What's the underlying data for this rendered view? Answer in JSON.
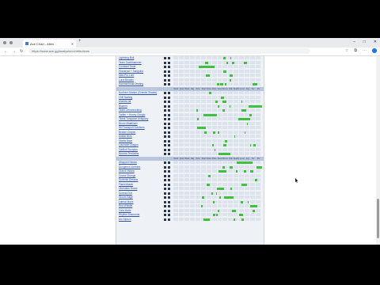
{
  "browser": {
    "tab_title": "Ace Chart - Alten",
    "url": "https://www.ace.gg/analysis/contributions",
    "icons": [
      "back-icon",
      "forward-icon",
      "reload-icon",
      "star-icon",
      "extensions-icon",
      "profile-icon",
      "menu-icon"
    ]
  },
  "table": {
    "column_labels": [
      "Rank",
      "Qual",
      "Week",
      "Day",
      "Time",
      "Total",
      "Notes",
      "Pace",
      "Seed",
      "Bonus",
      "Kills",
      "Deaths",
      "Level",
      "Avg",
      "Tier",
      "Pts"
    ],
    "groups": [
      {
        "players": [
          "Lightning Bolt",
          "Team Gachihammer",
          "Constant Droid",
          "Flowerpot + Sanguine",
          "Idea Pro Lord",
          "Luna Breaker",
          "Hammerhead Dealing"
        ]
      },
      {
        "players": [
          "Northern Marker (Gremlin Sharks)",
          "Cliff Starling",
          "shadow.rat",
          "Bluenet",
          "Team Lemonrocking",
          "Twitter + Honey Giorgio",
          "Tiktok Turquoise Antiquary",
          "Bruno Malatinski",
          "WXTransport Solutions",
          "Broken Crayon",
          "Avatar Bros",
          "Starfix Base",
          "Lavender Dragon",
          "GalBolt Scorpion",
          "Nuevos Terciados"
        ]
      },
      {
        "players": [
          "Whipped Nectar",
          "Dungeons Vorthem",
          "Grand Vistara",
          "Sound Strange",
          "Sorrento Dreams",
          "Flamenhawk",
          "Liberation Brand",
          "Surreal Cult",
          "Gloom Sage",
          "Lateral Move",
          "Red Whistle",
          "Gala Matte",
          "Rhythm Diamonds",
          "Arc Siphon"
        ]
      }
    ]
  }
}
